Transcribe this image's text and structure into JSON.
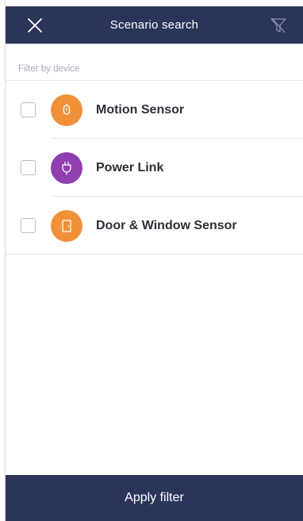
{
  "header": {
    "title": "Scenario search",
    "close_icon": "close-icon",
    "filter_icon": "filter-clear-icon"
  },
  "filter": {
    "section_label": "Filter by device",
    "devices": [
      {
        "label": "Motion Sensor",
        "checked": false,
        "icon": "motion-sensor-icon",
        "color": "#f0913a"
      },
      {
        "label": "Power Link",
        "checked": false,
        "icon": "power-plug-icon",
        "color": "#8f3fb0"
      },
      {
        "label": "Door & Window Sensor",
        "checked": false,
        "icon": "door-sensor-icon",
        "color": "#f0913a"
      }
    ]
  },
  "footer": {
    "apply_label": "Apply filter"
  },
  "colors": {
    "header_bg": "#2b3559",
    "accent_orange": "#f0913a",
    "accent_purple": "#8f3fb0"
  }
}
